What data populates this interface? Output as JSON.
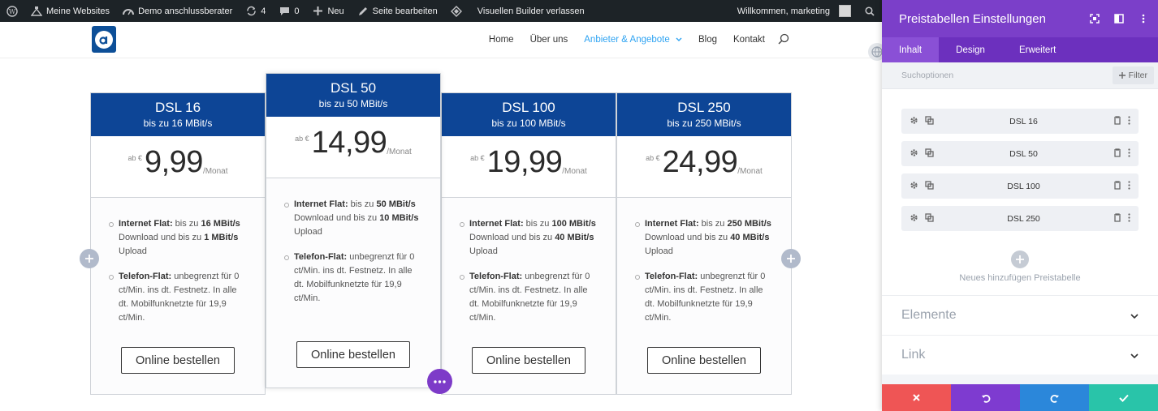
{
  "admin_bar": {
    "sites": "Meine Websites",
    "site_name": "Demo anschlussberater",
    "updates_count": "4",
    "comments_count": "0",
    "new_label": "Neu",
    "edit_page": "Seite bearbeiten",
    "exit_builder": "Visuellen Builder verlassen",
    "welcome": "Willkommen, marketing"
  },
  "nav": {
    "items": [
      "Home",
      "Über uns",
      "Anbieter & Angebote",
      "Blog",
      "Kontakt"
    ],
    "active": "Anbieter & Angebote"
  },
  "pricing_tables": [
    {
      "title": "DSL 16",
      "subtitle": "bis zu 16 MBit/s",
      "currency": "ab €",
      "price": "9,99",
      "period": "/Monat",
      "features": [
        {
          "label": "Internet Flat:",
          "text": " bis zu ",
          "b1": "16 MBit/s",
          "t2": " Download und bis zu ",
          "b2": "1 MBit/s",
          "t3": " Upload"
        },
        {
          "label": "Telefon-Flat:",
          "text": " unbegrenzt für 0 ct/Min. ins dt. Festnetz. In alle dt. Mobilfunknetzte für 19,9 ct/Min."
        }
      ],
      "button": "Online bestellen"
    },
    {
      "title": "DSL 50",
      "subtitle": "bis zu 50 MBit/s",
      "currency": "ab €",
      "price": "14,99",
      "period": "/Monat",
      "features": [
        {
          "label": "Internet Flat:",
          "text": " bis zu ",
          "b1": "50 MBit/s",
          "t2": " Download und bis zu ",
          "b2": "10 MBit/s",
          "t3": " Upload"
        },
        {
          "label": "Telefon-Flat:",
          "text": " unbegrenzt für 0 ct/Min. ins dt. Festnetz. In alle dt. Mobilfunknetzte für 19,9 ct/Min."
        }
      ],
      "button": "Online bestellen"
    },
    {
      "title": "DSL 100",
      "subtitle": "bis zu 100 MBit/s",
      "currency": "ab €",
      "price": "19,99",
      "period": "/Monat",
      "features": [
        {
          "label": "Internet Flat:",
          "text": " bis zu ",
          "b1": "100 MBit/s",
          "t2": " Download und bis zu ",
          "b2": "40 MBit/s",
          "t3": " Upload"
        },
        {
          "label": "Telefon-Flat:",
          "text": " unbegrenzt für 0 ct/Min. ins dt. Festnetz. In alle dt. Mobilfunknetzte für 19,9 ct/Min."
        }
      ],
      "button": "Online bestellen"
    },
    {
      "title": "DSL 250",
      "subtitle": "bis zu 250 MBit/s",
      "currency": "ab €",
      "price": "24,99",
      "period": "/Monat",
      "features": [
        {
          "label": "Internet Flat:",
          "text": " bis zu ",
          "b1": "250 MBit/s",
          "t2": " Download und bis zu ",
          "b2": "40 MBit/s",
          "t3": " Upload"
        },
        {
          "label": "Telefon-Flat:",
          "text": " unbegrenzt für 0 ct/Min. ins dt. Festnetz. In alle dt. Mobilfunknetzte für 19,9 ct/Min."
        }
      ],
      "button": "Online bestellen"
    }
  ],
  "panel": {
    "title": "Preistabellen Einstellungen",
    "tabs": [
      "Inhalt",
      "Design",
      "Erweitert"
    ],
    "active_tab": "Inhalt",
    "search_label": "Suchoptionen",
    "filter_label": "Filter",
    "items": [
      "DSL 16",
      "DSL 50",
      "DSL 100",
      "DSL 250"
    ],
    "add_label": "Neues hinzufügen Preistabelle",
    "sections": [
      "Elemente",
      "Link"
    ]
  },
  "colors": {
    "header_blue": "#0d4596",
    "builder_purple": "#7b3fc9",
    "cancel": "#ef5555",
    "undo": "#7e3bd0",
    "redo": "#2b87da",
    "save": "#29c4a9"
  }
}
